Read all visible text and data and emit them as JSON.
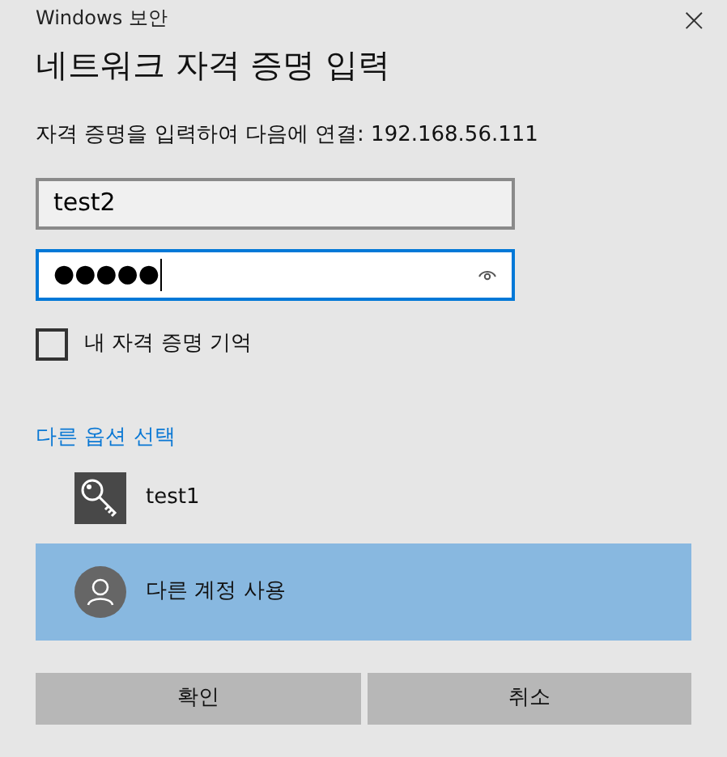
{
  "window": {
    "title": "Windows 보안",
    "close": "×"
  },
  "heading": "네트워크 자격 증명 입력",
  "prompt": "자격 증명을 입력하여 다음에 연결: 192.168.56.111",
  "username": {
    "value": "test2",
    "focused": false
  },
  "password": {
    "value": "●●●●●",
    "focused": true
  },
  "remember": {
    "label": "내 자격 증명 기억",
    "checked": false
  },
  "more_choices": "다른 옵션 선택",
  "accounts": [
    {
      "kind": "key",
      "label": "test1",
      "selected": false
    },
    {
      "kind": "person",
      "label": "다른 계정 사용",
      "selected": true
    }
  ],
  "buttons": [
    "확인",
    "취소"
  ]
}
